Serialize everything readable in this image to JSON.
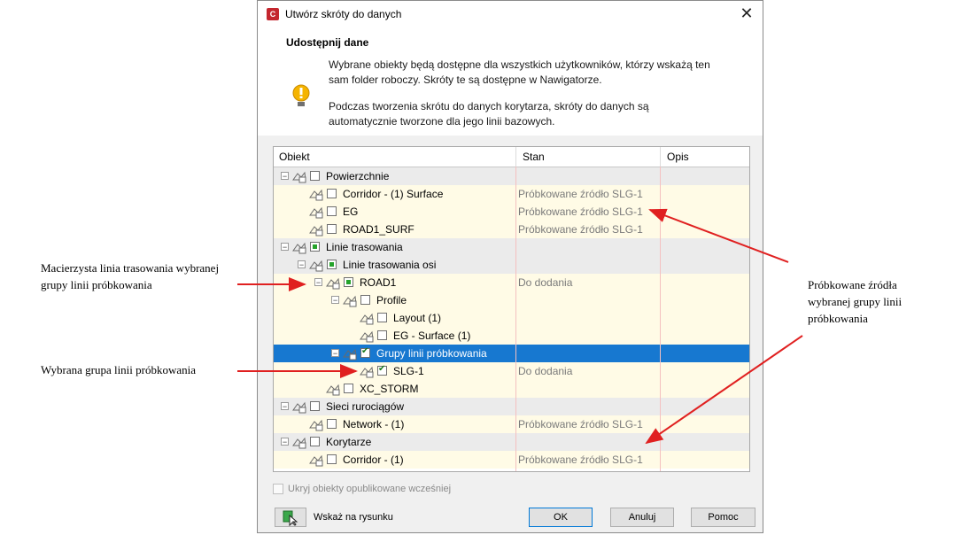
{
  "dialog": {
    "title": "Utwórz skróty do danych",
    "app_icon_letter": "C",
    "header_title": "Udostępnij dane",
    "info1": "Wybrane obiekty będą dostępne dla wszystkich użytkowników, którzy wskażą ten sam folder roboczy. Skróty te są dostępne w Nawigatorze.",
    "info2": "Podczas tworzenia skrótu do danych korytarza, skróty do danych są automatycznie tworzone dla jego linii bazowych."
  },
  "grid": {
    "columns": [
      "Obiekt",
      "Stan",
      "Opis"
    ],
    "rows": [
      {
        "label": "Powierzchnie",
        "stan": "",
        "level": 0,
        "kind": "group",
        "check": "none"
      },
      {
        "label": "Corridor - (1) Surface",
        "stan": "Próbkowane źródło SLG-1",
        "level": 1,
        "kind": "item",
        "check": "none"
      },
      {
        "label": "EG",
        "stan": "Próbkowane źródło SLG-1",
        "level": 1,
        "kind": "item",
        "check": "none"
      },
      {
        "label": "ROAD1_SURF",
        "stan": "Próbkowane źródło SLG-1",
        "level": 1,
        "kind": "item",
        "check": "none"
      },
      {
        "label": "Linie trasowania",
        "stan": "",
        "level": 0,
        "kind": "group",
        "check": "part"
      },
      {
        "label": "Linie trasowania osi",
        "stan": "",
        "level": 1,
        "kind": "group",
        "check": "part"
      },
      {
        "label": "ROAD1",
        "stan": "Do dodania",
        "level": 2,
        "kind": "item",
        "check": "part"
      },
      {
        "label": "Profile",
        "stan": "",
        "level": 3,
        "kind": "item",
        "check": "none"
      },
      {
        "label": "Layout (1)",
        "stan": "",
        "level": 4,
        "kind": "item",
        "check": "none"
      },
      {
        "label": "EG - Surface (1)",
        "stan": "",
        "level": 4,
        "kind": "item",
        "check": "none"
      },
      {
        "label": "Grupy linii próbkowania",
        "stan": "",
        "level": 3,
        "kind": "sel",
        "check": "checked"
      },
      {
        "label": "SLG-1",
        "stan": "Do dodania",
        "level": 4,
        "kind": "item",
        "check": "checked"
      },
      {
        "label": "XC_STORM",
        "stan": "",
        "level": 2,
        "kind": "item",
        "check": "none"
      },
      {
        "label": "Sieci ruroci ągów",
        "stan": "",
        "level": 0,
        "kind": "group",
        "check": "none"
      },
      {
        "label": "Network - (1)",
        "stan": "Próbkowane źródło SLG-1",
        "level": 1,
        "kind": "item",
        "check": "none"
      },
      {
        "label": "Korytarze",
        "stan": "",
        "level": 0,
        "kind": "group",
        "check": "none"
      },
      {
        "label": "Corridor - (1)",
        "stan": "Próbkowane źródło SLG-1",
        "level": 1,
        "kind": "item",
        "check": "none"
      }
    ]
  },
  "footer": {
    "hide_label": "Ukryj obiekty opublikowane wcześniej",
    "pick_label": "Wskaż na rysunku",
    "ok": "OK",
    "cancel": "Anuluj",
    "help": "Pomoc"
  },
  "annotations": {
    "left1": "Macierzysta linia trasowania wybranej grupy linii próbkowania",
    "left2": "Wybrana grupa linii próbkowania",
    "right": "Próbkowane źródła wybranej grupy linii próbkowania"
  },
  "colors": {
    "selection": "#1778d0",
    "arrow": "#e02020",
    "app_icon": "#c4262e"
  }
}
